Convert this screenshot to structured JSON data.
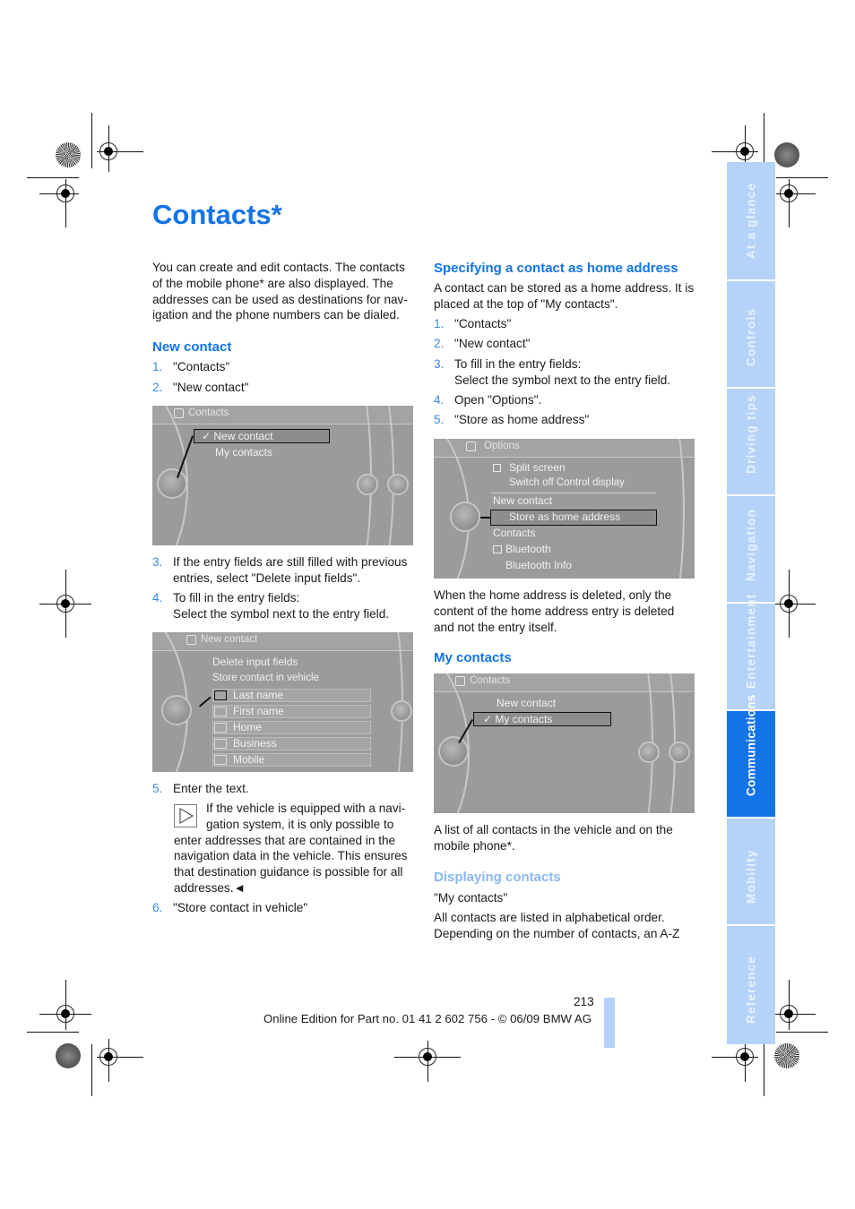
{
  "page": {
    "title": "Contacts*",
    "page_number": "213",
    "footer": "Online Edition for Part no. 01 41 2 602 756 - © 06/09 BMW AG"
  },
  "side_tabs": [
    {
      "label": "At a glance",
      "active": false
    },
    {
      "label": "Controls",
      "active": false
    },
    {
      "label": "Driving tips",
      "active": false
    },
    {
      "label": "Navigation",
      "active": false
    },
    {
      "label": "Entertainment",
      "active": false
    },
    {
      "label": "Communications",
      "active": true
    },
    {
      "label": "Mobility",
      "active": false
    },
    {
      "label": "Reference",
      "active": false
    }
  ],
  "colors": {
    "accent": "#1473e6",
    "tab_inactive": "#b5d3f8",
    "subheading_light": "#8ab8f0"
  },
  "left": {
    "intro": [
      "You can create and edit contacts. The contacts",
      "of the mobile phone* are also displayed. The",
      "addresses can be used as destinations for nav-",
      "igation and the phone numbers can be dialed."
    ],
    "new_contact_heading": "New contact",
    "steps_a": [
      {
        "num": "1.",
        "text": "\"Contacts\""
      },
      {
        "num": "2.",
        "text": "\"New contact\""
      }
    ],
    "steps_b": [
      {
        "num": "3.",
        "lines": [
          "If the entry fields are still filled with previous",
          "entries, select \"Delete input fields\"."
        ]
      },
      {
        "num": "4.",
        "lines": [
          "To fill in the entry fields:",
          "Select the symbol next to the entry field."
        ]
      }
    ],
    "step5": {
      "num": "5.",
      "text": "Enter the text."
    },
    "note_icon": "play-triangle-icon",
    "note": [
      "If the vehicle is equipped with a navi-",
      "gation system, it is only possible to",
      "enter addresses that are contained in the",
      "navigation data in the vehicle. This ensures",
      "that destination guidance is possible for all",
      "addresses.◄"
    ],
    "step6": {
      "num": "6.",
      "text": "\"Store contact in vehicle\""
    }
  },
  "right": {
    "home_heading": "Specifying a contact as home address",
    "home_intro": [
      "A contact can be stored as a home address. It is",
      "placed at the top of \"My contacts\"."
    ],
    "home_steps": [
      {
        "num": "1.",
        "lines": [
          "\"Contacts\""
        ]
      },
      {
        "num": "2.",
        "lines": [
          "\"New contact\""
        ]
      },
      {
        "num": "3.",
        "lines": [
          "To fill in the entry fields:",
          "Select the symbol next to the entry field."
        ]
      },
      {
        "num": "4.",
        "lines": [
          "Open \"Options\"."
        ]
      },
      {
        "num": "5.",
        "lines": [
          "\"Store as home address\""
        ]
      }
    ],
    "home_deleted": [
      "When the home address is deleted, only the",
      "content of the home address entry is deleted",
      "and not the entry itself."
    ],
    "my_contacts_heading": "My contacts",
    "my_contacts_text": [
      "A list of all contacts in the vehicle and on the",
      "mobile phone*."
    ],
    "displaying_heading": "Displaying contacts",
    "displaying_step": "\"My contacts\"",
    "displaying_text": [
      "All contacts are listed in alphabetical order.",
      "Depending on the number of contacts, an A-Z"
    ]
  },
  "screens": {
    "contacts_menu_1": {
      "header": "Contacts",
      "items": [
        "✓ New contact",
        "My contacts"
      ],
      "selected": 0
    },
    "new_contact": {
      "header": "New contact",
      "items": [
        "Delete input fields",
        "Store contact in vehicle"
      ],
      "fields": [
        "Last name",
        "First name",
        "Home",
        "Business",
        "Mobile"
      ],
      "selected_field": 0
    },
    "options": {
      "header": "Options",
      "items": [
        "Split screen",
        "Switch off Control display",
        "New contact",
        "Store as home address",
        "Contacts",
        "Bluetooth",
        "Bluetooth Info"
      ],
      "selected": 3
    },
    "contacts_menu_2": {
      "header": "Contacts",
      "items": [
        "New contact",
        "✓ My contacts"
      ],
      "selected": 1
    }
  }
}
